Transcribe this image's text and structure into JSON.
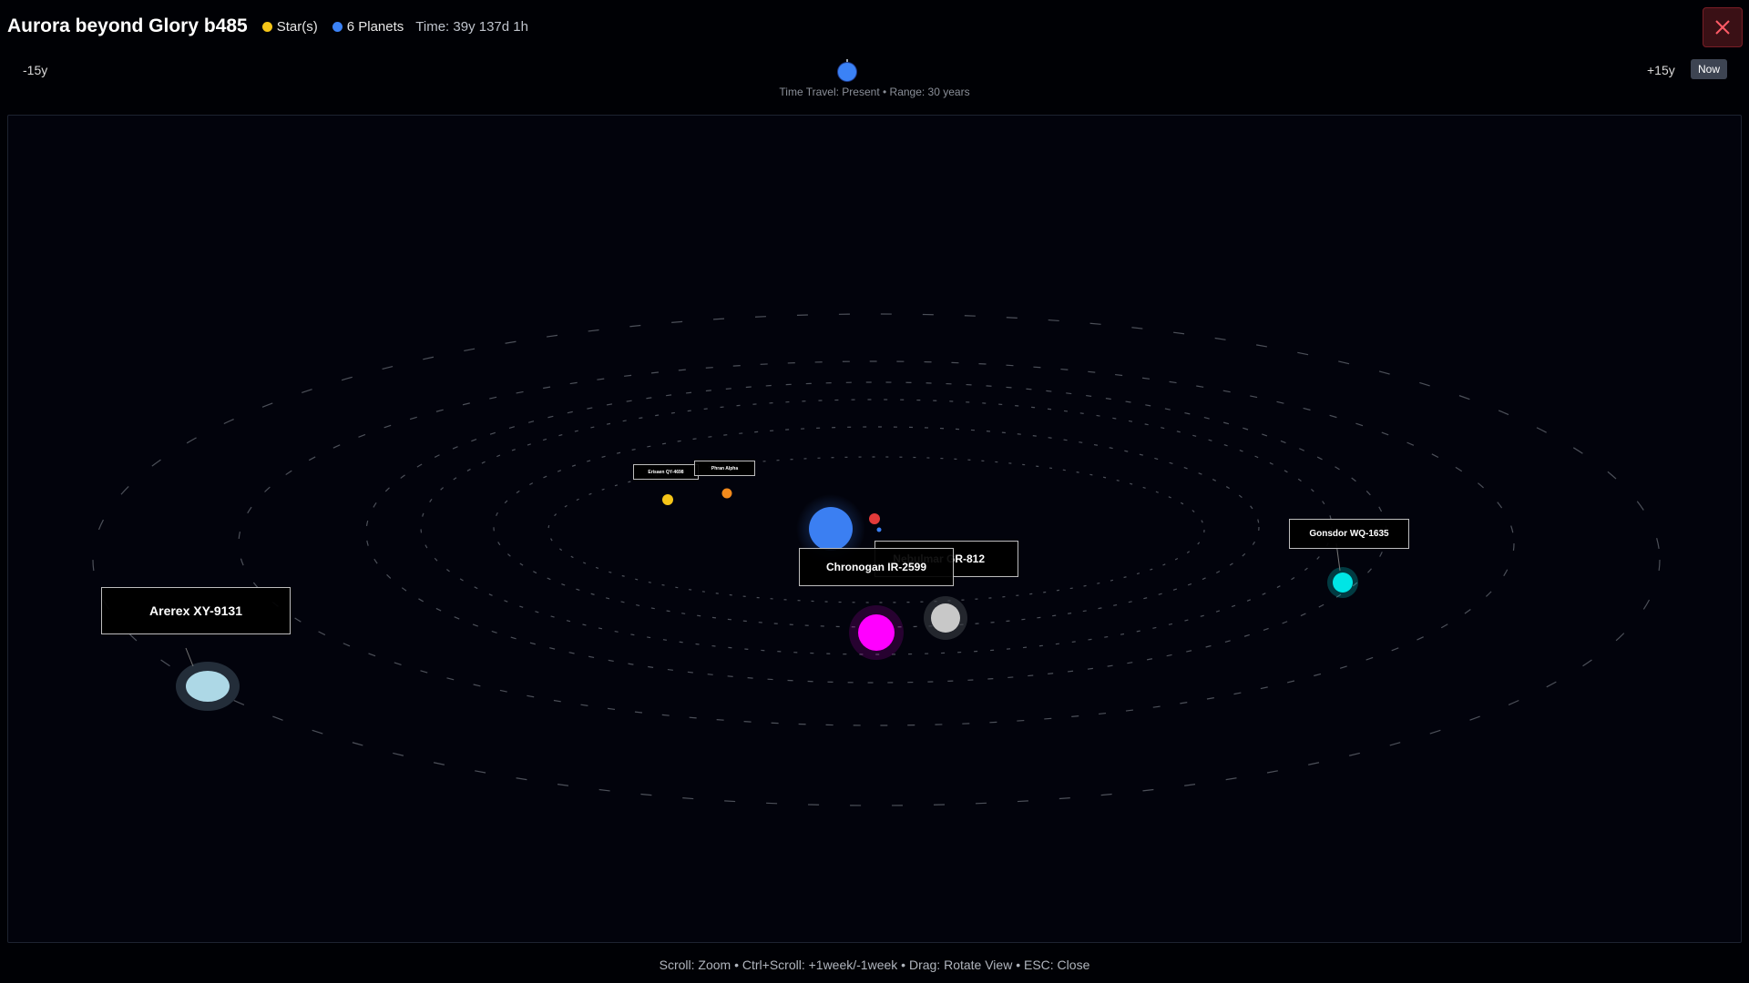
{
  "header": {
    "title": "Aurora beyond Glory b485",
    "legend_stars": "Star(s)",
    "legend_planets": "6 Planets",
    "time": "Time: 39y 137d 1h",
    "star_color": "#f5c518",
    "planet_color": "#3b82f6",
    "close_icon": "close-icon"
  },
  "timeline": {
    "min_label": "-15y",
    "max_label": "+15y",
    "now_label": "Now",
    "caption": "Time Travel: Present • Range: 30 years",
    "position": 0.5
  },
  "scene": {
    "labels": {
      "arerex": "Arerex XY-9131",
      "chronogan": "Chronogan IR-2599",
      "nebulmar": "Nebulmar GR-812",
      "gonsdor": "Gonsdor WQ-1635",
      "small1": "Erisaen QY-4698",
      "small2": "Phran Alpha"
    },
    "colors": {
      "star": "#3b7ff2",
      "arerex": "#add8e6",
      "chronogan": "#ff00ff",
      "nebulmar": "#c8c8c8",
      "gonsdor": "#00e5e5",
      "moon_red": "#e23a3a",
      "small_yellow": "#f5c518",
      "small_orange": "#f28a1c"
    }
  },
  "footer": {
    "hint": "Scroll: Zoom • Ctrl+Scroll: +1week/-1week • Drag: Rotate View • ESC: Close"
  }
}
